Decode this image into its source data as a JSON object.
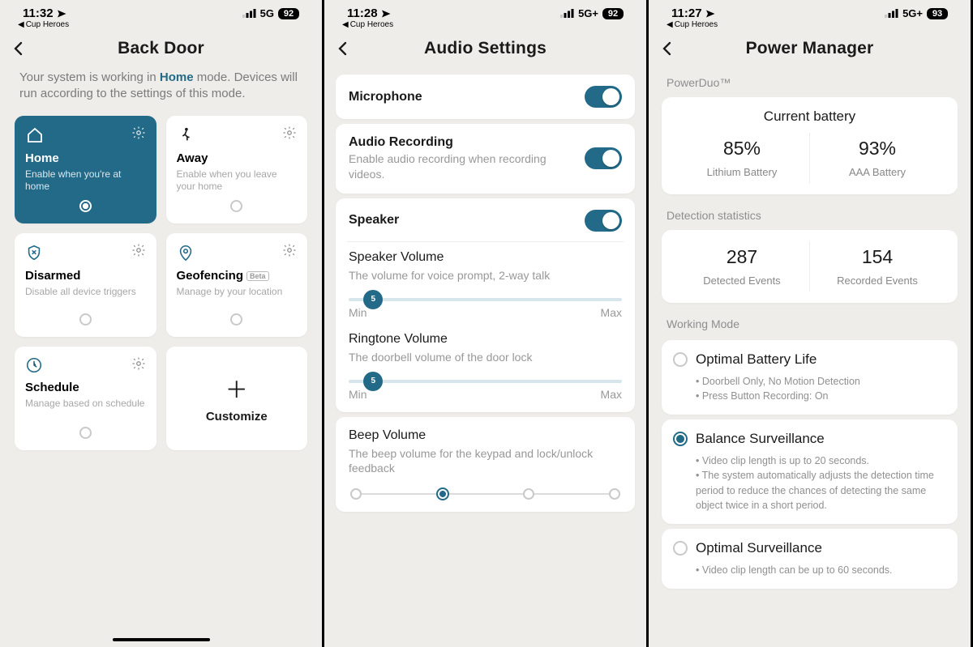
{
  "screen1": {
    "status": {
      "time": "11:32",
      "breadcrumb": "Cup Heroes",
      "net": "5G",
      "battery": "92"
    },
    "title": "Back Door",
    "intro_pre": "Your system is working in ",
    "intro_mode": "Home",
    "intro_post": " mode. Devices will run according to the settings of this mode.",
    "cards": {
      "home": {
        "title": "Home",
        "sub": "Enable when you're at home"
      },
      "away": {
        "title": "Away",
        "sub": "Enable when you leave your home"
      },
      "disarmed": {
        "title": "Disarmed",
        "sub": "Disable all device triggers"
      },
      "geof": {
        "title": "Geofencing",
        "sub": "Manage by your location",
        "badge": "Beta"
      },
      "schedule": {
        "title": "Schedule",
        "sub": "Manage based on schedule"
      },
      "custom": {
        "title": "Customize"
      }
    }
  },
  "screen2": {
    "status": {
      "time": "11:28",
      "breadcrumb": "Cup Heroes",
      "net": "5G+",
      "battery": "92"
    },
    "title": "Audio Settings",
    "mic": {
      "label": "Microphone"
    },
    "rec": {
      "label": "Audio Recording",
      "sub": "Enable audio recording when recording videos."
    },
    "speaker": {
      "label": "Speaker"
    },
    "spkvol": {
      "label": "Speaker Volume",
      "sub": "The volume for voice prompt, 2-way talk",
      "val": "5"
    },
    "ringvol": {
      "label": "Ringtone Volume",
      "sub": "The doorbell volume of the door lock",
      "val": "5"
    },
    "beep": {
      "label": "Beep Volume",
      "sub": "The beep volume for the keypad and lock/unlock feedback"
    },
    "min": "Min",
    "max": "Max"
  },
  "screen3": {
    "status": {
      "time": "11:27",
      "breadcrumb": "Cup Heroes",
      "net": "5G+",
      "battery": "93"
    },
    "title": "Power Manager",
    "powerduo": "PowerDuo™",
    "battery_card": {
      "title": "Current battery",
      "a_pct": "85%",
      "a_lab": "Lithium Battery",
      "b_pct": "93%",
      "b_lab": "AAA Battery"
    },
    "detect_label": "Detection statistics",
    "detect": {
      "a_n": "287",
      "a_lab": "Detected Events",
      "b_n": "154",
      "b_lab": "Recorded Events"
    },
    "wm_label": "Working Mode",
    "opt_batt": {
      "title": "Optimal Battery Life",
      "b1": "Doorbell Only, No Motion Detection",
      "b2": "Press Button Recording: On"
    },
    "balance": {
      "title": "Balance Surveillance",
      "b1": "Video clip length is up to 20 seconds.",
      "b2": "The system automatically adjusts the detection time period to reduce the chances of detecting the same object twice in a short period."
    },
    "opt_surv": {
      "title": "Optimal Surveillance",
      "b1": "Video clip length can be up to 60 seconds."
    }
  }
}
